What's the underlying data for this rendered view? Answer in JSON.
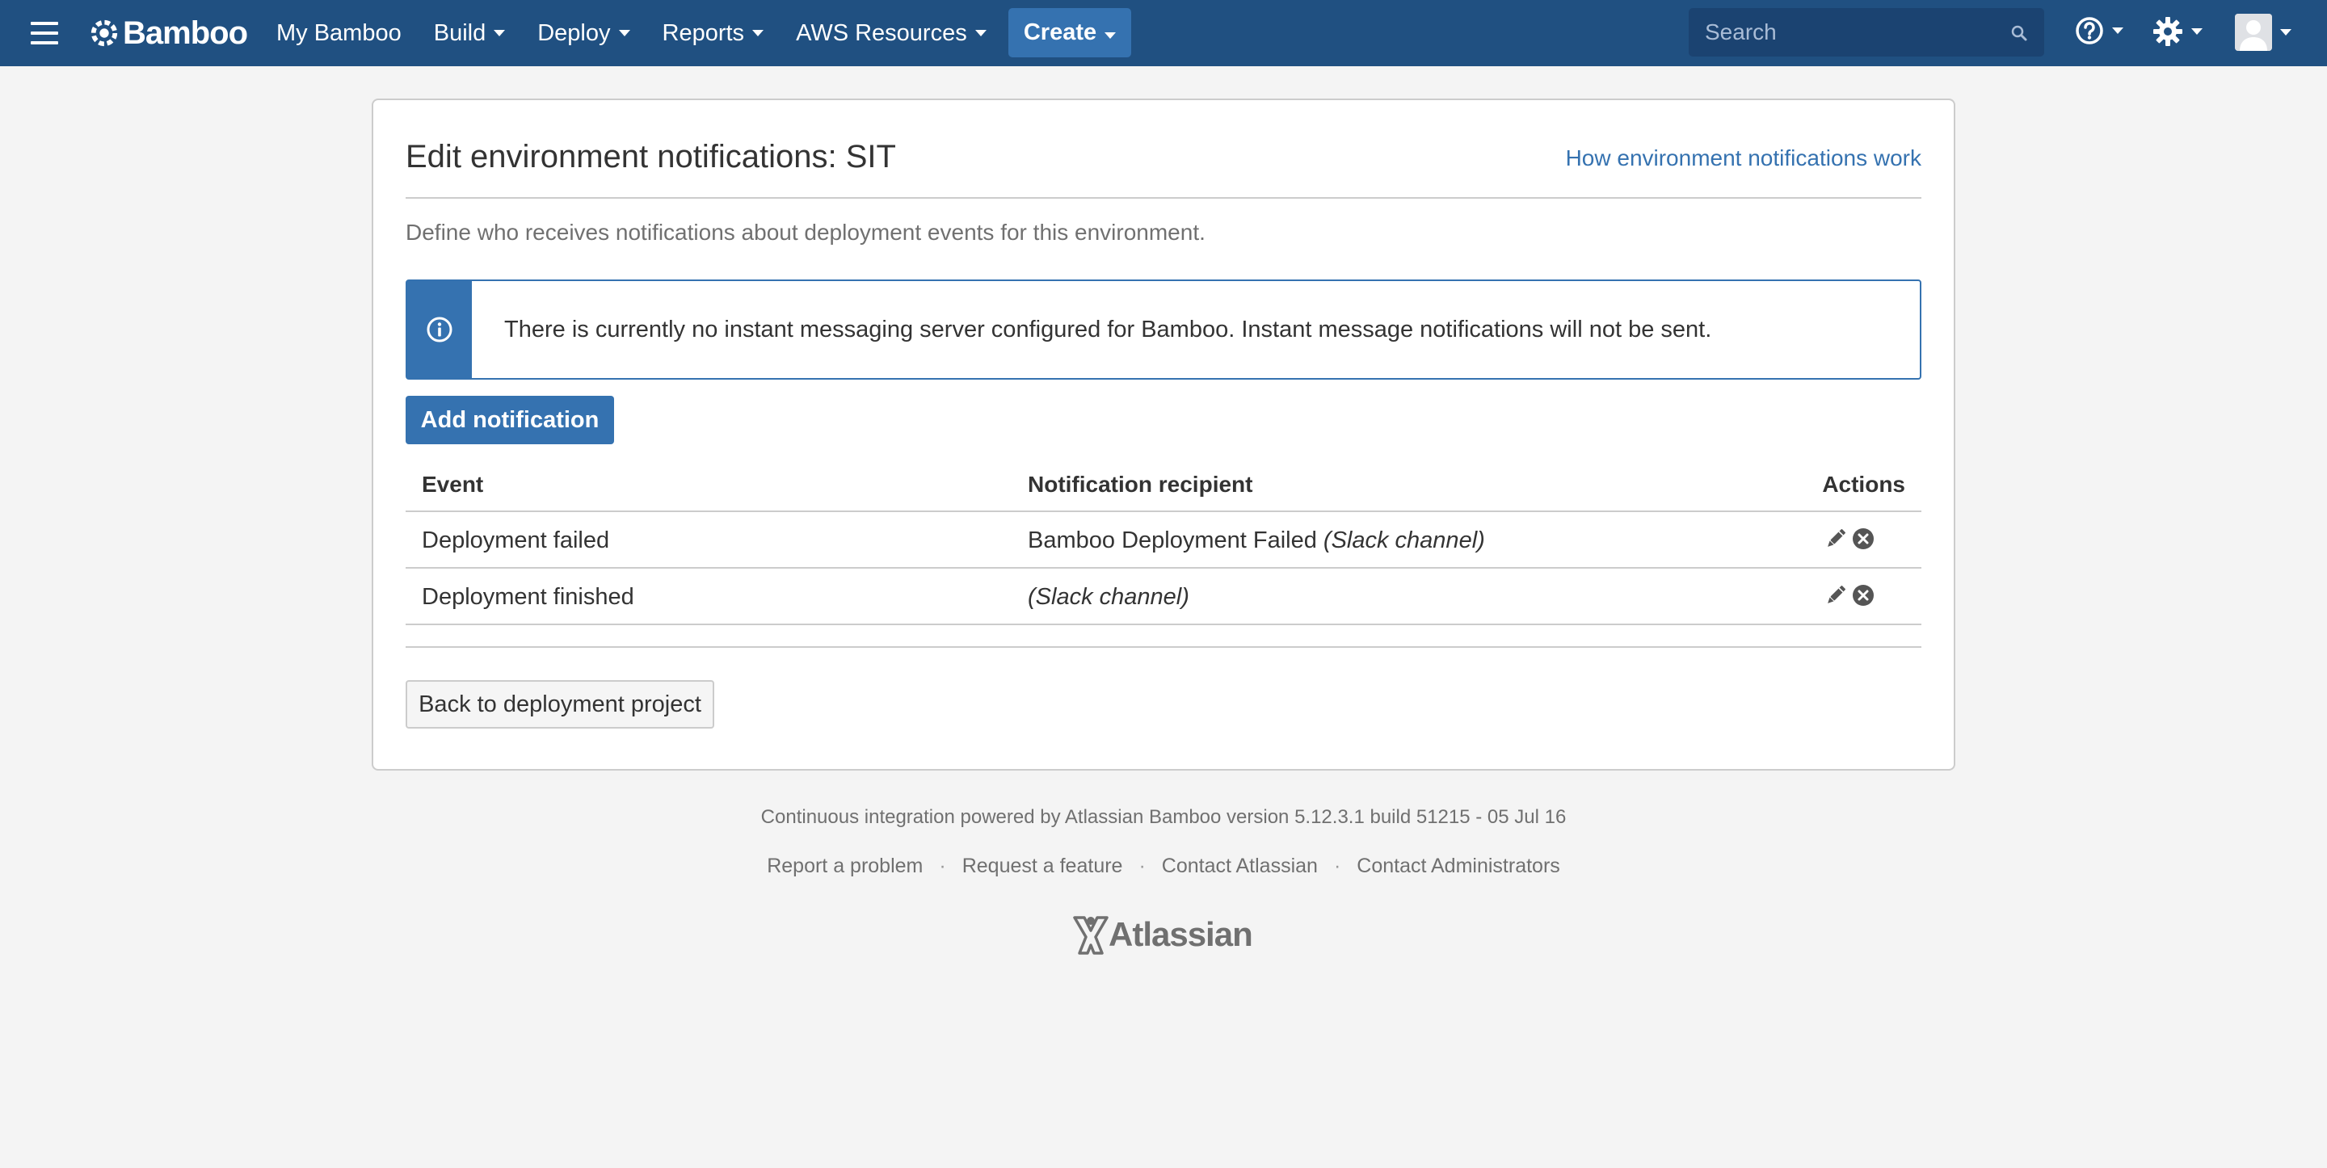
{
  "header": {
    "brand": "Bamboo",
    "nav": [
      {
        "label": "My Bamboo"
      },
      {
        "label": "Build"
      },
      {
        "label": "Deploy"
      },
      {
        "label": "Reports"
      },
      {
        "label": "AWS Resources"
      }
    ],
    "create_label": "Create",
    "search_placeholder": "Search",
    "icons": [
      "menu-icon",
      "search-icon",
      "help-icon",
      "gear-icon",
      "avatar"
    ],
    "colors": {
      "bar": "#205081",
      "create": "#3572b0",
      "search": "#1b4371"
    }
  },
  "page": {
    "title": "Edit environment notifications: SIT",
    "help_link": "How environment notifications work",
    "description": "Define who receives notifications about deployment events for this environment.",
    "info_message": "There is currently no instant messaging server configured for Bamboo. Instant message notifications will not be sent.",
    "add_button": "Add notification",
    "back_button": "Back to deployment project"
  },
  "table": {
    "headers": {
      "event": "Event",
      "recipient": "Notification recipient",
      "actions": "Actions"
    },
    "rows": [
      {
        "event": "Deployment failed",
        "recipient_name": "Bamboo Deployment Failed",
        "recipient_type": "(Slack channel)"
      },
      {
        "event": "Deployment finished",
        "recipient_name": "",
        "recipient_type": "(Slack channel)"
      }
    ],
    "row_action_icons": [
      "edit-icon",
      "delete-icon"
    ]
  },
  "footer": {
    "powered_by": "Continuous integration powered by Atlassian Bamboo version 5.12.3.1 build 51215 - 05 Jul 16",
    "links": [
      "Report a problem",
      "Request a feature",
      "Contact Atlassian",
      "Contact Administrators"
    ],
    "logo_text": "Atlassian"
  }
}
